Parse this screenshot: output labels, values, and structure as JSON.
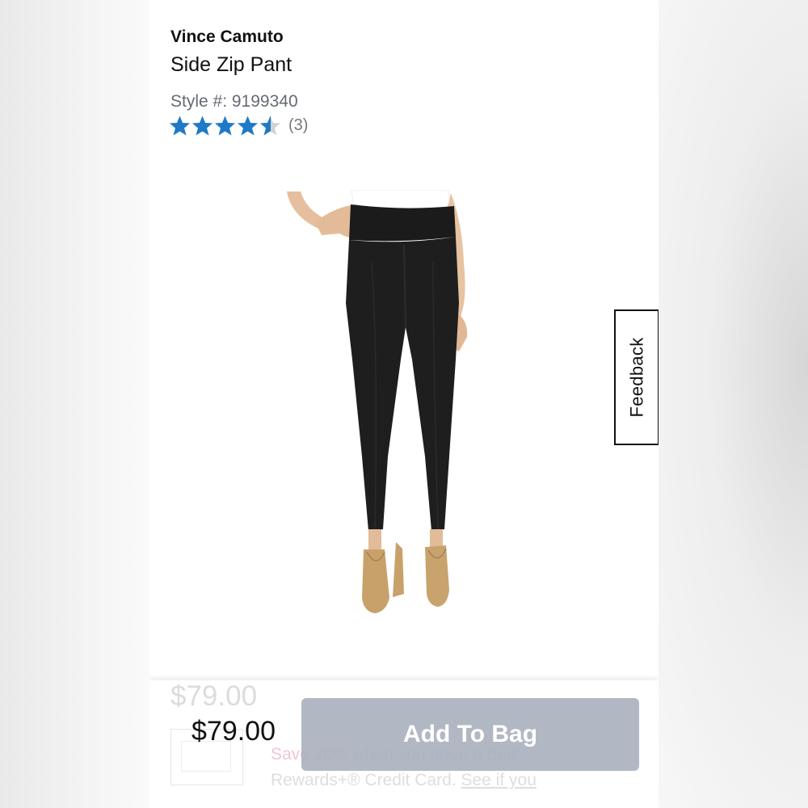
{
  "product": {
    "brand": "Vince Camuto",
    "name": "Side Zip Pant",
    "style_label": "Style #: 9199340",
    "rating": {
      "value": 4.5,
      "max": 5,
      "count_text": "(3)"
    },
    "image_icon": "product-photo"
  },
  "feedback_tab": {
    "label": "Feedback"
  },
  "purchase_bar": {
    "ghost_price": "$79.00",
    "price": "$79.00",
    "add_to_bag_label": "Add To Bag",
    "promo_save": "Save 20%",
    "promo_text": " when you open a Belk Rewards+® Credit Card. ",
    "promo_link": "See if you"
  },
  "colors": {
    "star": "#1e7ac7",
    "star_empty": "#cfd3d8",
    "button_bg": "#aab0bc",
    "text": "#111111",
    "muted": "#666a73"
  }
}
